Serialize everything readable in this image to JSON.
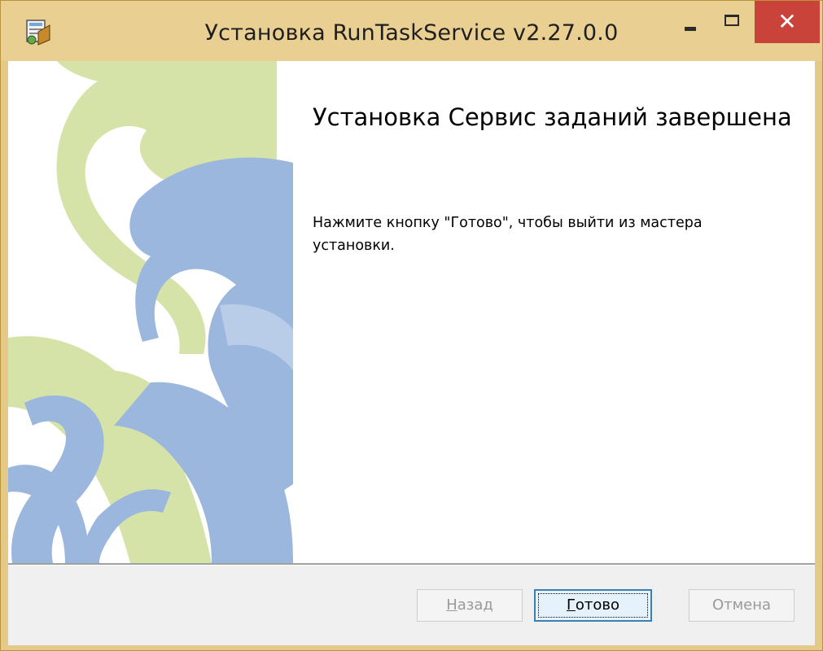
{
  "window": {
    "title": "Установка RunTaskService v2.27.0.0",
    "controls": {
      "minimize": "—",
      "maximize": "□",
      "close": "✕"
    },
    "title_bar_color": "#e9cf92",
    "close_button_color": "#c9433a",
    "icon": "installer-icon"
  },
  "wizard": {
    "heading": "Установка Сервис заданий завершена",
    "message": "Нажмите кнопку \"Готово\", чтобы выйти из мастера установки.",
    "side_image": "wizard-side-art"
  },
  "buttons": {
    "back": {
      "access_key": "Н",
      "rest": "азад",
      "enabled": false
    },
    "finish": {
      "access_key": "Г",
      "rest": "отово",
      "enabled": true
    },
    "cancel": {
      "label": "Отмена",
      "enabled": false
    }
  },
  "colors": {
    "art_green": "#d6e3a8",
    "art_blue": "#9bb7de",
    "focus_border": "#3c7fb1"
  }
}
